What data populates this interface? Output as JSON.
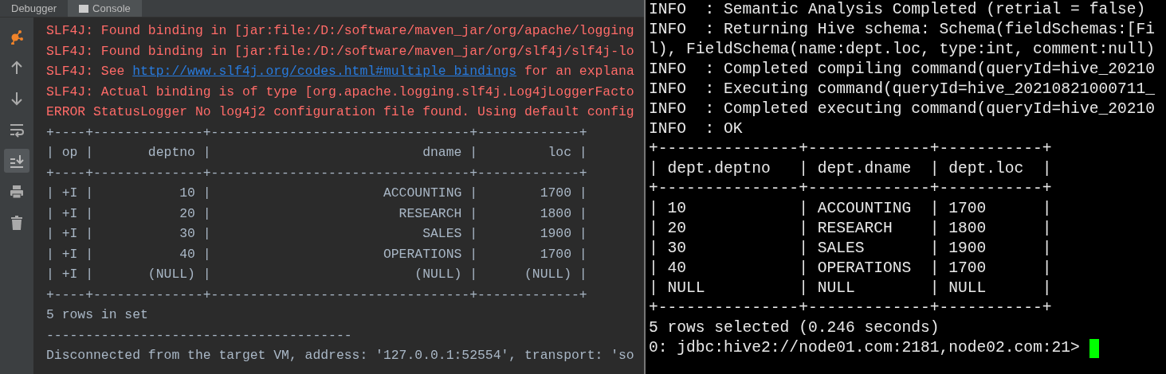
{
  "ide_console": {
    "tabs": [
      {
        "label": "Debugger",
        "selected": false
      },
      {
        "label": "Console",
        "selected": true
      }
    ],
    "tools": [
      {
        "kind": "debug",
        "selected": false
      },
      {
        "kind": "up",
        "selected": false
      },
      {
        "kind": "down",
        "selected": false
      },
      {
        "kind": "wrap",
        "selected": false
      },
      {
        "kind": "scroll_end",
        "selected": true
      },
      {
        "kind": "print",
        "selected": false
      },
      {
        "kind": "trash",
        "selected": false
      }
    ],
    "lines": [
      {
        "kind": "error",
        "text": "SLF4J: Found binding in [jar:file:/D:/software/maven_jar/org/apache/logging"
      },
      {
        "kind": "error",
        "text": "SLF4J: Found binding in [jar:file:/D:/software/maven_jar/org/slf4j/slf4j-lo"
      },
      {
        "kind": "error_link",
        "before": "SLF4J: See ",
        "link": "http://www.slf4j.org/codes.html#multiple_bindings",
        "after": " for an explana"
      },
      {
        "kind": "error",
        "text": "SLF4J: Actual binding is of type [org.apache.logging.slf4j.Log4jLoggerFacto"
      },
      {
        "kind": "error",
        "text": "ERROR StatusLogger No log4j2 configuration file found. Using default config"
      },
      {
        "kind": "output",
        "text": "+----+--------------+---------------------------------+-------------+"
      },
      {
        "kind": "output",
        "text": "| op |       deptno |                           dname |         loc |"
      },
      {
        "kind": "output",
        "text": "+----+--------------+---------------------------------+-------------+"
      },
      {
        "kind": "output",
        "text": "| +I |           10 |                      ACCOUNTING |        1700 |"
      },
      {
        "kind": "output",
        "text": "| +I |           20 |                        RESEARCH |        1800 |"
      },
      {
        "kind": "output",
        "text": "| +I |           30 |                           SALES |        1900 |"
      },
      {
        "kind": "output",
        "text": "| +I |           40 |                      OPERATIONS |        1700 |"
      },
      {
        "kind": "output",
        "text": "| +I |       (NULL) |                          (NULL) |      (NULL) |"
      },
      {
        "kind": "output",
        "text": "+----+--------------+---------------------------------+-------------+"
      },
      {
        "kind": "output",
        "text": "5 rows in set"
      },
      {
        "kind": "output",
        "text": "---------------------------------------"
      },
      {
        "kind": "output",
        "text": "Disconnected from the target VM, address: '127.0.0.1:52554', transport: 'so"
      }
    ]
  },
  "terminal": {
    "lines": [
      "INFO  : Semantic Analysis Completed (retrial = false)",
      "INFO  : Returning Hive schema: Schema(fieldSchemas:[Fi",
      "l), FieldSchema(name:dept.loc, type:int, comment:null)",
      "INFO  : Completed compiling command(queryId=hive_20210",
      "INFO  : Executing command(queryId=hive_20210821000711_",
      "INFO  : Completed executing command(queryId=hive_20210",
      "INFO  : OK",
      "+---------------+-------------+-----------+",
      "| dept.deptno   | dept.dname  | dept.loc  |",
      "+---------------+-------------+-----------+",
      "| 10            | ACCOUNTING  | 1700      |",
      "| 20            | RESEARCH    | 1800      |",
      "| 30            | SALES       | 1900      |",
      "| 40            | OPERATIONS  | 1700      |",
      "| NULL          | NULL        | NULL      |",
      "+---------------+-------------+-----------+",
      "5 rows selected (0.246 seconds)"
    ],
    "prompt": "0: jdbc:hive2://node01.com:2181,node02.com:21>"
  }
}
